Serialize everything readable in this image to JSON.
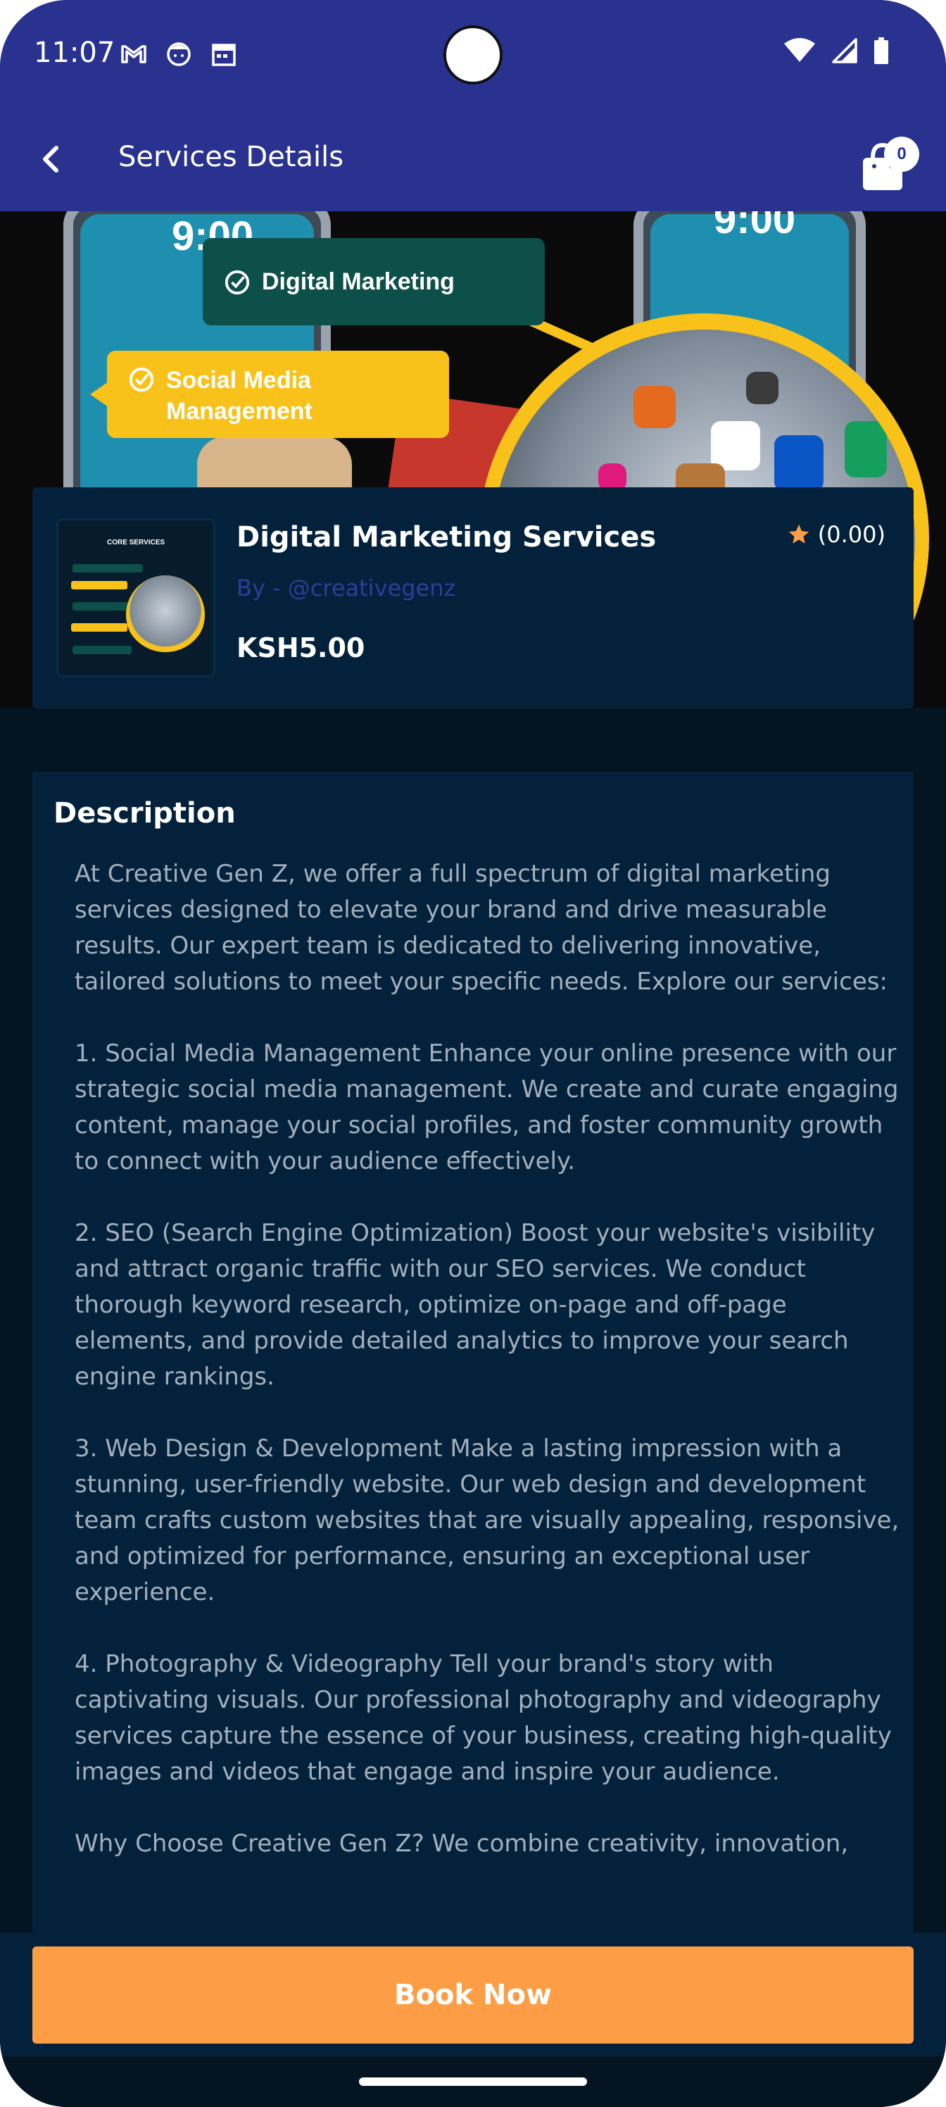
{
  "status_bar": {
    "time": "11:07",
    "left_icons": [
      "gmail-icon",
      "face-icon",
      "calendar-icon"
    ],
    "right_icons": [
      "wifi-icon",
      "signal-icon",
      "battery-icon"
    ]
  },
  "app_bar": {
    "title": "Services Details",
    "back_icon": "arrow-back-icon",
    "cart_icon": "shopping-bag-icon",
    "cart_count": "0",
    "background": "#2a3290"
  },
  "banner": {
    "tag_1": "Digital Marketing",
    "tag_2_line_1": "Social Media",
    "tag_2_line_2": "Management",
    "mock_time_left": "9:00",
    "mock_time_right": "9:00"
  },
  "product": {
    "title": "Digital Marketing Services",
    "author": "By - @creativegenz",
    "price": "KSH5.00",
    "rating": "(0.00)",
    "rating_icon": "star-icon",
    "thumbnail_title": "CORE SERVICES"
  },
  "description": {
    "heading": "Description",
    "body": "At Creative Gen Z, we offer a full spectrum of digital marketing services designed to elevate your brand and drive measurable results. Our expert team is dedicated to delivering innovative, tailored solutions to meet your specific needs. Explore our services:\n\n1. Social Media Management Enhance your online presence with our strategic social media management. We create and curate engaging content, manage your social profiles, and foster community growth to connect with your audience effectively.\n\n2. SEO (Search Engine Optimization) Boost your website's visibility and attract organic traffic with our SEO services. We conduct thorough keyword research, optimize on-page and off-page elements, and provide detailed analytics to improve your search engine rankings.\n\n3. Web Design & Development Make a lasting impression with a stunning, user-friendly website. Our web design and development team crafts custom websites that are visually appealing, responsive, and optimized for performance, ensuring an exceptional user experience.\n\n4. Photography & Videography Tell your brand's story with captivating visuals. Our professional photography and videography services capture the essence of your business, creating high-quality images and videos that engage and inspire your audience.\n\nWhy Choose Creative Gen Z? We combine creativity, innovation,"
  },
  "actions": {
    "book_now": "Book Now",
    "accent": "#fd9d46"
  }
}
